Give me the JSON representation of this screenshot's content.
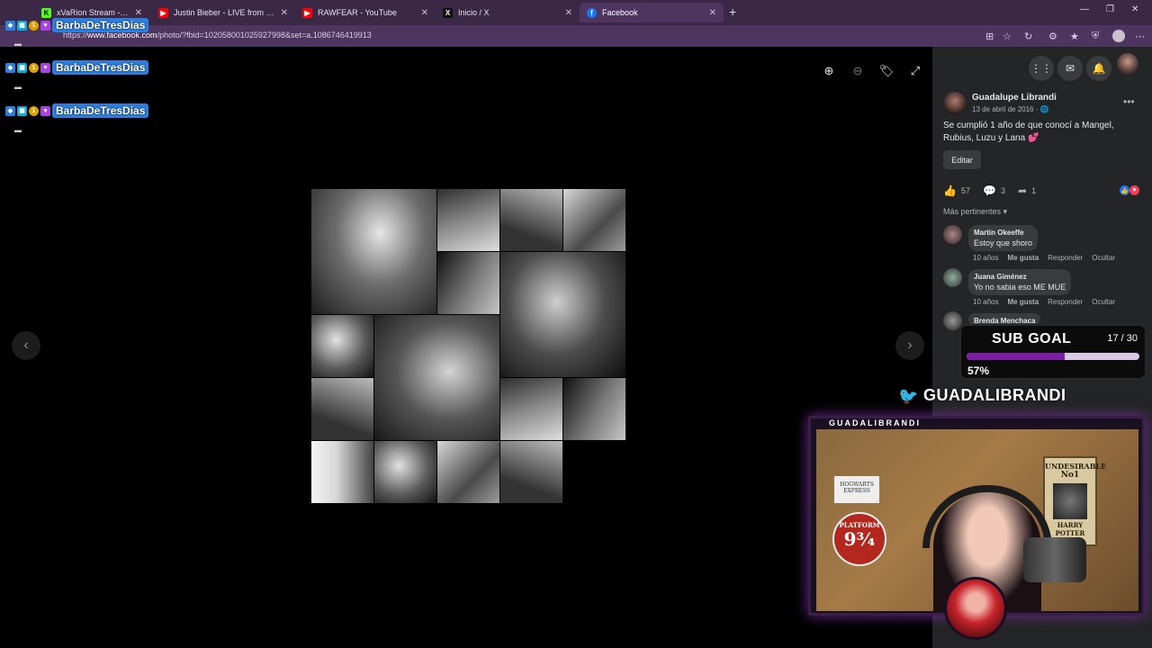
{
  "browser": {
    "tabs": [
      {
        "title": "xVaRion Stream - Watch Live",
        "icon": "kick-icon",
        "color": "#53fc18"
      },
      {
        "title": "Justin Bieber - LIVE from Coachella",
        "icon": "youtube-icon",
        "color": "#ff0000"
      },
      {
        "title": "RAWFEAR - YouTube",
        "icon": "youtube-icon",
        "color": "#ff0000"
      },
      {
        "title": "Inicio / X",
        "icon": "x-icon",
        "color": "#000000"
      },
      {
        "title": "Facebook",
        "icon": "facebook-icon",
        "color": "#1877f2",
        "active": true
      }
    ],
    "url_prefix": "https://",
    "url_host": "www.facebook.com",
    "url_path": "/photo/?fbid=102058001025927998&set=a.1086746419913"
  },
  "viewer": {
    "next_glyph": "›",
    "prev_glyph": "‹"
  },
  "post": {
    "author": "Guadalupe Librandi",
    "date": "13 de abril de 2016 · ",
    "caption": "Se cumplió 1 año de que conocí a Mangel, Rubius, Luzu y Lana 💕",
    "edit_label": "Editar",
    "likes": "57",
    "comments": "3",
    "shares": "1",
    "sort_label": "Más pertinentes ▾"
  },
  "comments": [
    {
      "name": "Martin Okeeffe",
      "text": "Estoy que shoro",
      "age": "10 años",
      "like": "Me gusta",
      "reply": "Responder",
      "hide": "Ocultar"
    },
    {
      "name": "Juana Giménez",
      "text": "Yo no sabia eso ME MUE",
      "age": "10 años",
      "like": "Me gusta",
      "reply": "Responder",
      "hide": "Ocultar"
    },
    {
      "name": "Brenda Menchaca",
      "text": "",
      "age": "",
      "like": "",
      "reply": "",
      "hide": ""
    }
  ],
  "overlay": {
    "chat_name": "BarbaDeTresDias",
    "sub_goal_label": "SUB GOAL",
    "sub_goal_count": "17 / 30",
    "sub_goal_progress": 0.57,
    "sub_goal_percent": "57%",
    "twitter_handle": "GUADALIBRANDI",
    "cam_title": "GUADALIBRANDI",
    "poster_line1": "UNDESIRABLE",
    "poster_line2": "No1",
    "poster_line3": "HARRY POTTER",
    "sticker_line1": "PLATFORM",
    "sticker_line2": "9¾",
    "hogwarts": "HOGWARTS EXPRESS"
  }
}
